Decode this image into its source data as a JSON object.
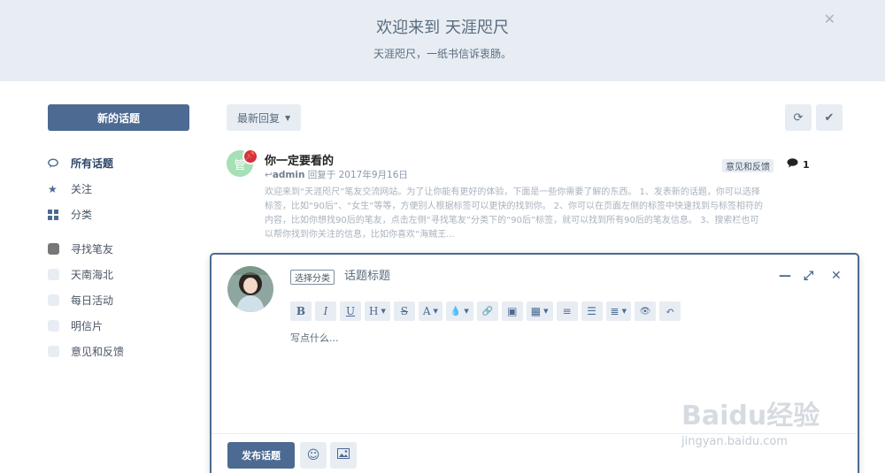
{
  "hero": {
    "title": "欢迎来到 天涯咫尺",
    "subtitle": "天涯咫尺，一纸书信诉衷肠。"
  },
  "sidebar": {
    "new_discussion": "新的话题",
    "nav": [
      {
        "label": "所有话题",
        "icon": "comments-icon"
      },
      {
        "label": "关注",
        "icon": "star-icon"
      },
      {
        "label": "分类",
        "icon": "grid-icon"
      }
    ],
    "tags": [
      {
        "label": "寻找笔友",
        "color": "#777777"
      },
      {
        "label": "天南海北",
        "color": "#e7edf3"
      },
      {
        "label": "每日活动",
        "color": "#e7edf3"
      },
      {
        "label": "明信片",
        "color": "#e7edf3"
      },
      {
        "label": "意见和反馈",
        "color": "#e7edf3"
      }
    ]
  },
  "toolbar": {
    "sort_label": "最新回复"
  },
  "discussion": {
    "avatar_letter": "管",
    "title": "你一定要看的",
    "author": "admin",
    "meta": "回复于 2017年9月16日",
    "tag": "意见和反馈",
    "reply_count": "1",
    "excerpt": "欢迎来到“天涯咫尺”笔友交流网站。为了让你能有更好的体验，下面是一些你需要了解的东西。 1、发表新的话题，你可以选择标签，比如“90后”、“女生”等等，方便别人根据标签可以更快的找到你。 2、你可以在页面左侧的标签中快速找到与标签相符的内容，比如你想找90后的笔友，点击左侧“寻找笔友”分类下的“90后”标签，就可以找到所有90后的笔友信息。 3、搜索栏也可以帮你找到你关注的信息，比如你喜欢“海贼王..."
  },
  "composer": {
    "category_btn": "选择分类",
    "title_placeholder": "话题标题",
    "body_placeholder": "写点什么...",
    "publish": "发布话题",
    "format_buttons": [
      {
        "label": "B",
        "name": "bold-button"
      },
      {
        "label": "I",
        "name": "italic-button"
      },
      {
        "label": "U",
        "name": "underline-button"
      },
      {
        "label": "H",
        "name": "heading-button",
        "caret": true
      },
      {
        "label": "S",
        "name": "strikethrough-button"
      },
      {
        "label": "A",
        "name": "font-color-button",
        "caret": true
      },
      {
        "label": "💧",
        "name": "highlight-button",
        "caret": true
      },
      {
        "label": "🔗",
        "name": "link-button"
      },
      {
        "label": "▣",
        "name": "image-button"
      },
      {
        "label": "▦",
        "name": "qrcode-button",
        "caret": true
      },
      {
        "label": "≡",
        "name": "ordered-list-button"
      },
      {
        "label": "☰",
        "name": "unordered-list-button"
      },
      {
        "label": "≣",
        "name": "align-button",
        "caret": true
      },
      {
        "label": "👁",
        "name": "preview-button"
      },
      {
        "label": "↶",
        "name": "undo-button"
      }
    ]
  },
  "watermark": {
    "main": "Baidu经验",
    "sub": "jingyan.baidu.com"
  }
}
